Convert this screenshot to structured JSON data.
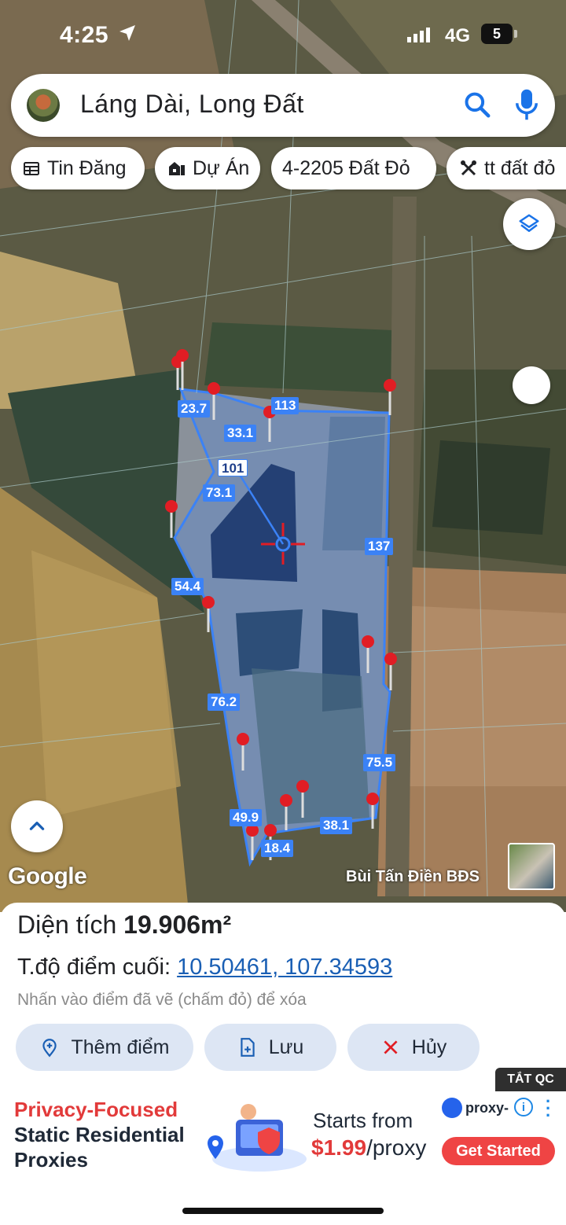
{
  "status_bar": {
    "time": "4:25",
    "network": "4G",
    "battery": "5"
  },
  "search": {
    "query": "Láng Dài, Long Đất"
  },
  "chips": [
    {
      "label": "Tin Đăng",
      "icon": "calendar-icon"
    },
    {
      "label": "Dự Án",
      "icon": "building-icon"
    },
    {
      "label": "4-2205 Đất Đỏ",
      "icon": ""
    },
    {
      "label": "tt đất đỏ",
      "icon": "tools-icon"
    }
  ],
  "map": {
    "attribution": "Bùi Tấn Điền BĐS",
    "google": "Google",
    "segment_lengths": [
      "23.7",
      "113",
      "33.1",
      "101",
      "73.1",
      "137",
      "54.4",
      "76.2",
      "75.5",
      "49.9",
      "18.4",
      "38.1"
    ]
  },
  "sheet": {
    "area_label": "Diện tích",
    "area_value": "19.906m²",
    "coord_label": "T.độ điểm cuối:",
    "coord_value": "10.50461, 107.34593",
    "hint": "Nhấn vào điểm đã vẽ (chấm đỏ) để xóa",
    "buttons": {
      "add": "Thêm điểm",
      "save": "Lưu",
      "cancel": "Hủy"
    }
  },
  "ad": {
    "hide_label": "TẮT QC",
    "headline_1": "Privacy-Focused",
    "headline_2": "Static Residential",
    "headline_3": "Proxies",
    "starts_from": "Starts from",
    "price": "$1.99",
    "price_suffix": "/proxy",
    "brand": "proxy-",
    "cta": "Get Started"
  },
  "colors": {
    "accent": "#1a5fb4",
    "polygon": "#3b82f6",
    "pin": "#e11d24",
    "ad_red": "#ef4444"
  }
}
